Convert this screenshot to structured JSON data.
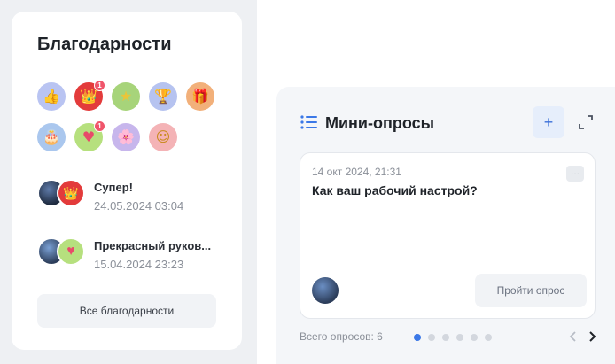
{
  "thanks": {
    "title": "Благодарности",
    "badges": [
      {
        "icon": "thumbs-up-icon",
        "glyph": "👍",
        "bg": "#b9c4f2",
        "count": ""
      },
      {
        "icon": "crown-icon",
        "glyph": "👑",
        "bg": "#e33b3b",
        "count": "1"
      },
      {
        "icon": "star-icon",
        "glyph": "★",
        "bg": "#a7d47a",
        "count": ""
      },
      {
        "icon": "trophy-icon",
        "glyph": "🏆",
        "bg": "#b6c3f0",
        "count": ""
      },
      {
        "icon": "gift-icon",
        "glyph": "🎁",
        "bg": "#f2b07a",
        "count": ""
      },
      {
        "icon": "cake-icon",
        "glyph": "🎂",
        "bg": "#aac7ee",
        "count": ""
      },
      {
        "icon": "heart-icon",
        "glyph": "♥",
        "bg": "#b6e07e",
        "count": "1"
      },
      {
        "icon": "flower-icon",
        "glyph": "🌸",
        "bg": "#c7b6ec",
        "count": ""
      },
      {
        "icon": "smile-icon",
        "glyph": "☺",
        "bg": "#f4b3b6",
        "count": ""
      }
    ],
    "entries": [
      {
        "name": "Супер!",
        "date": "24.05.2024 03:04"
      },
      {
        "name": "Прекрасный руков...",
        "date": "15.04.2024 23:23"
      }
    ],
    "all_button": "Все благодарности"
  },
  "polls": {
    "title": "Мини-опросы",
    "add_label": "+",
    "card": {
      "date": "14 окт 2024, 21:31",
      "question": "Как ваш рабочий настрой?",
      "more_label": "···",
      "take_button": "Пройти опрос"
    },
    "total": "Всего опросов: 6",
    "pages": 6,
    "active_page": 1
  },
  "colors": {
    "accent": "#3b78e7",
    "badge_count": "#f0556b"
  }
}
